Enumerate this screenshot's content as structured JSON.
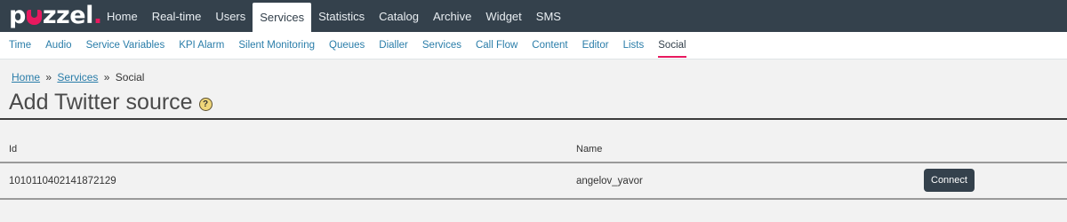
{
  "brand": {
    "logo_text_prefix": "p",
    "logo_text_suffix": "zzel",
    "logo_dot": ".",
    "accent_color": "#e8195f",
    "nav_bg_color": "#34414c"
  },
  "topnav": {
    "items": [
      {
        "label": "Home"
      },
      {
        "label": "Real-time"
      },
      {
        "label": "Users"
      },
      {
        "label": "Services",
        "active": true
      },
      {
        "label": "Statistics"
      },
      {
        "label": "Catalog"
      },
      {
        "label": "Archive"
      },
      {
        "label": "Widget"
      },
      {
        "label": "SMS"
      }
    ]
  },
  "subnav": {
    "items": [
      {
        "label": "Time"
      },
      {
        "label": "Audio"
      },
      {
        "label": "Service Variables"
      },
      {
        "label": "KPI Alarm"
      },
      {
        "label": "Silent Monitoring"
      },
      {
        "label": "Queues"
      },
      {
        "label": "Dialler"
      },
      {
        "label": "Services"
      },
      {
        "label": "Call Flow"
      },
      {
        "label": "Content"
      },
      {
        "label": "Editor"
      },
      {
        "label": "Lists"
      },
      {
        "label": "Social",
        "active": true
      }
    ]
  },
  "breadcrumb": {
    "home": "Home",
    "services": "Services",
    "current": "Social",
    "separator": "»"
  },
  "page": {
    "title": "Add Twitter source",
    "help_icon": "help-icon",
    "help_glyph": "?"
  },
  "table": {
    "columns": {
      "id": "Id",
      "name": "Name"
    },
    "rows": [
      {
        "id": "1010110402141872129",
        "name": "angelov_yavor",
        "action": "Connect"
      }
    ]
  }
}
